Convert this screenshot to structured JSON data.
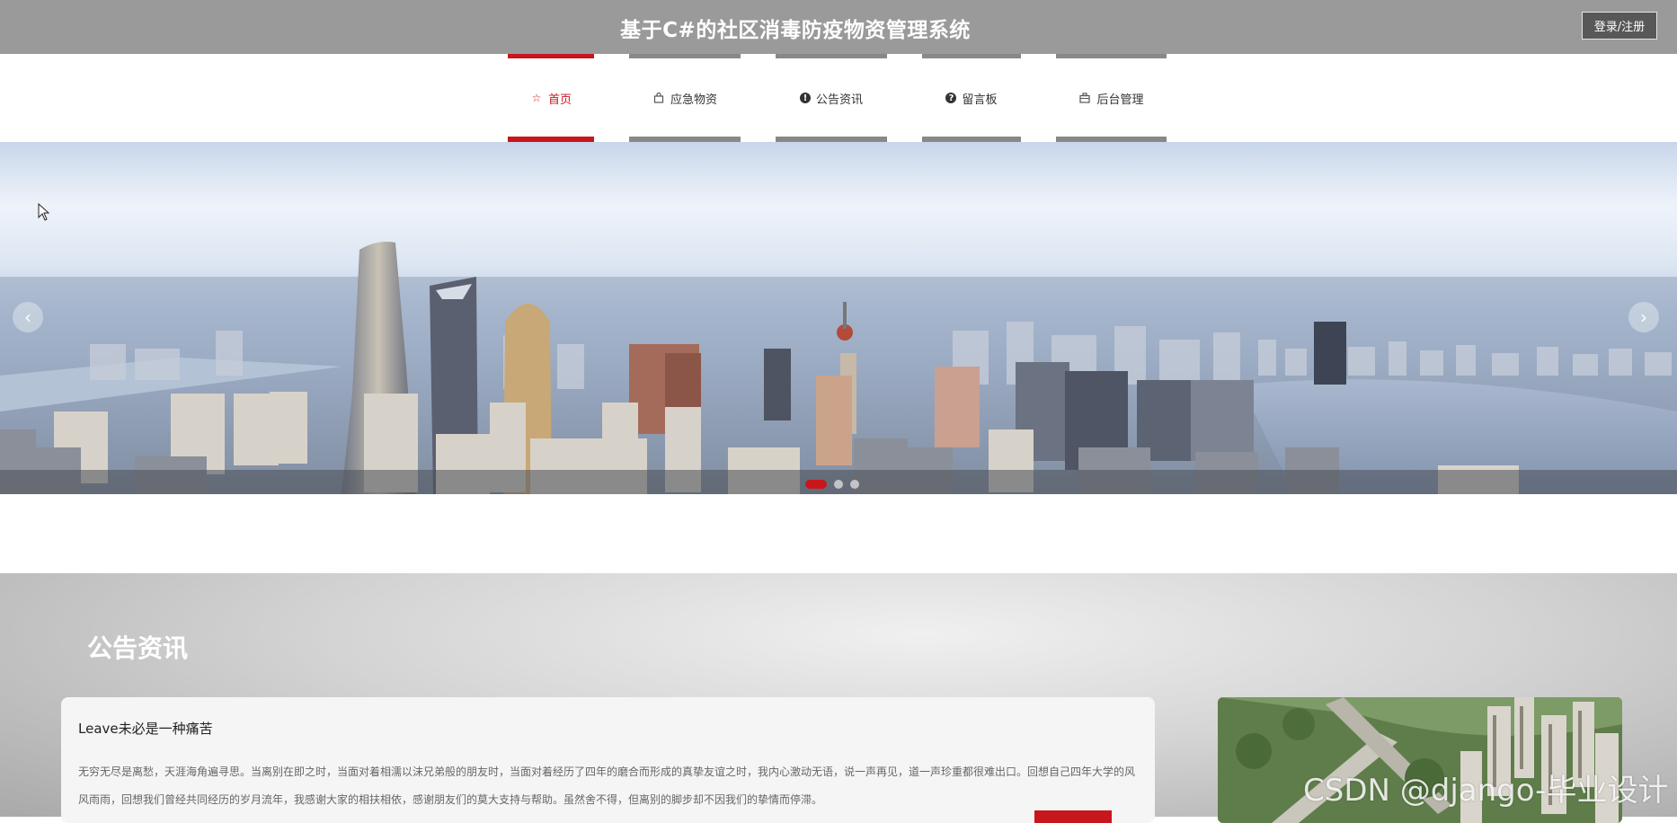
{
  "header": {
    "title": "基于C#的社区消毒防疫物资管理系统",
    "login_label": "登录/注册"
  },
  "nav": {
    "items": [
      {
        "label": "首页",
        "icon": "star-icon",
        "active": true
      },
      {
        "label": "应急物资",
        "icon": "shopping-bag-icon",
        "active": false
      },
      {
        "label": "公告资讯",
        "icon": "exclamation-circle-icon",
        "active": false
      },
      {
        "label": "留言板",
        "icon": "question-circle-icon",
        "active": false
      },
      {
        "label": "后台管理",
        "icon": "briefcase-icon",
        "active": false
      }
    ]
  },
  "banner": {
    "prev_glyph": "‹",
    "next_glyph": "›",
    "slide_count": 3,
    "active_slide": 1
  },
  "news": {
    "section_title": "公告资讯",
    "article": {
      "title": "Leave未必是一种痛苦",
      "body": "无穷无尽是离愁，天涯海角遍寻思。当离别在即之时，当面对着相濡以沫兄弟般的朋友时，当面对着经历了四年的磨合而形成的真挚友谊之时，我内心激动无语，说一声再见，道一声珍重都很难出口。回想自己四年大学的风风雨雨，回想我们曾经共同经历的岁月流年，我感谢大家的相扶相依，感谢朋友们的莫大支持与帮助。虽然舍不得，但离别的脚步却不因我们的挚情而停滞。"
    }
  },
  "watermark": "CSDN @django-毕业设计",
  "colors": {
    "accent": "#c8161d",
    "topbar": "#9a9a9a"
  }
}
